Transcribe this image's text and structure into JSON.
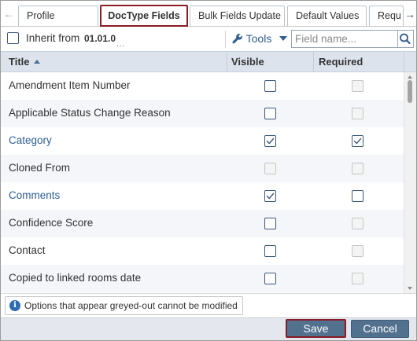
{
  "tabs": [
    {
      "label": "Profile",
      "active": false
    },
    {
      "label": "DocType Fields",
      "active": true
    },
    {
      "label": "Bulk Fields Update",
      "active": false
    },
    {
      "label": "Default Values",
      "active": false
    },
    {
      "label": "Requ",
      "active": false
    }
  ],
  "toolbar": {
    "inherit_label": "Inherit from",
    "inherit_version": "01.01.0",
    "inherit_ellipsis": "...",
    "inherit_checked": false,
    "tools_label": "Tools",
    "search_placeholder": "Field name..."
  },
  "grid": {
    "columns": [
      "Title",
      "Visible",
      "Required"
    ],
    "sort_column": "Title",
    "sort_direction": "ascending",
    "rows": [
      {
        "title": "Amendment Item Number",
        "link": false,
        "visible": "unchecked",
        "required": "disabled"
      },
      {
        "title": "Applicable Status Change Reason",
        "link": false,
        "visible": "unchecked",
        "required": "disabled"
      },
      {
        "title": "Category",
        "link": true,
        "visible": "checked",
        "required": "checked"
      },
      {
        "title": "Cloned From",
        "link": false,
        "visible": "disabled",
        "required": "disabled"
      },
      {
        "title": "Comments",
        "link": true,
        "visible": "checked",
        "required": "unchecked"
      },
      {
        "title": "Confidence Score",
        "link": false,
        "visible": "unchecked",
        "required": "disabled"
      },
      {
        "title": "Contact",
        "link": false,
        "visible": "unchecked",
        "required": "disabled"
      },
      {
        "title": "Copied to linked rooms date",
        "link": false,
        "visible": "unchecked",
        "required": "disabled"
      }
    ]
  },
  "footer": {
    "info_text": "Options that appear greyed-out cannot be modified",
    "save_label": "Save",
    "cancel_label": "Cancel"
  },
  "colors": {
    "accent": "#52718f",
    "highlight_border": "#8b1b24",
    "link": "#2d5e94",
    "header_bg": "#dce3ec"
  }
}
